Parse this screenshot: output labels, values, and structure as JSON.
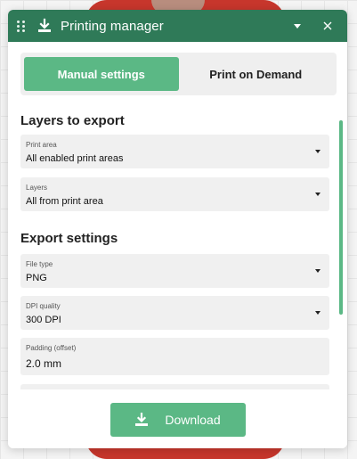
{
  "window": {
    "title": "Printing manager"
  },
  "tabs": [
    {
      "label": "Manual settings",
      "active": true
    },
    {
      "label": "Print on Demand",
      "active": false
    }
  ],
  "sections": {
    "layers": {
      "title": "Layers to export",
      "print_area": {
        "label": "Print area",
        "value": "All enabled print areas"
      },
      "layers": {
        "label": "Layers",
        "value": "All from print area"
      }
    },
    "export": {
      "title": "Export settings",
      "file_type": {
        "label": "File type",
        "value": "PNG"
      },
      "dpi": {
        "label": "DPI quality",
        "value": "300 DPI"
      },
      "padding": {
        "label": "Padding (offset)",
        "value": "2.0 mm"
      }
    }
  },
  "footer": {
    "download_label": "Download"
  },
  "colors": {
    "titlebar": "#2f7a58",
    "accent": "#5bb885",
    "field_bg": "#f0f0f0"
  },
  "icons": {
    "drag": "drag-handle-icon",
    "title": "download-icon",
    "dropdown": "chevron-down-icon",
    "close": "close-icon",
    "button": "download-icon"
  }
}
